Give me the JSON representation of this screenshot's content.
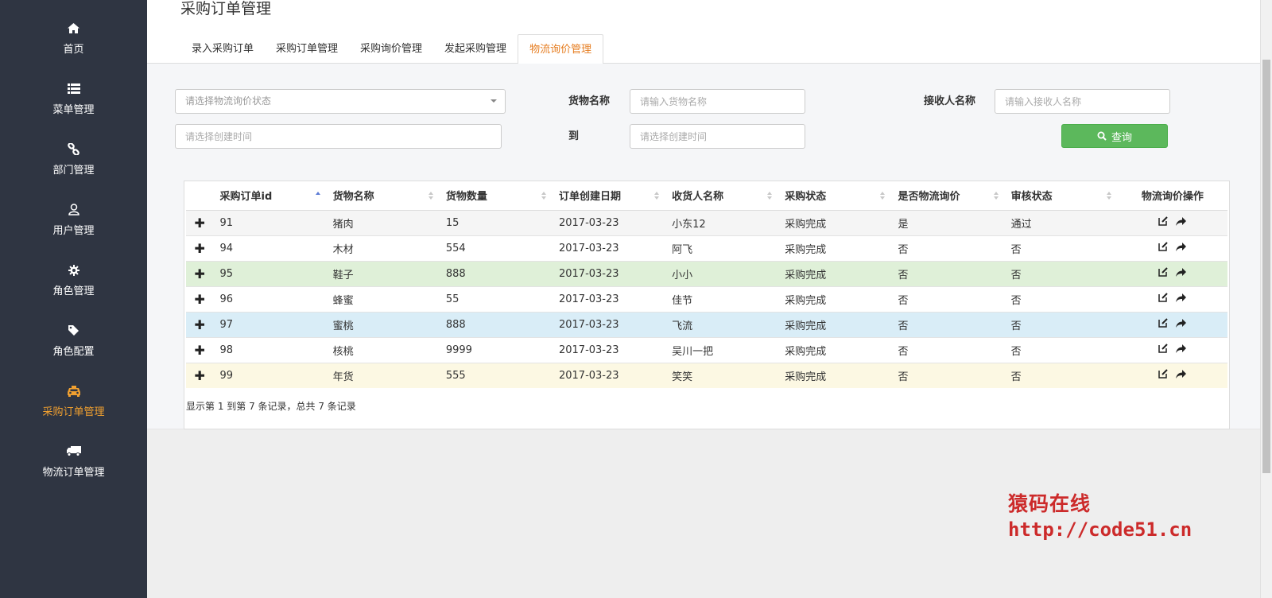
{
  "sidebar": {
    "items": [
      {
        "label": "首页",
        "icon": "home-icon"
      },
      {
        "label": "菜单管理",
        "icon": "list-icon"
      },
      {
        "label": "部门管理",
        "icon": "link-icon"
      },
      {
        "label": "用户管理",
        "icon": "user-icon"
      },
      {
        "label": "角色管理",
        "icon": "gear-icon"
      },
      {
        "label": "角色配置",
        "icon": "tag-icon"
      },
      {
        "label": "采购订单管理",
        "icon": "taxi-icon",
        "active": true
      },
      {
        "label": "物流订单管理",
        "icon": "truck-icon"
      }
    ],
    "active_color": "#f0a030"
  },
  "header": {
    "title": "采购订单管理",
    "tabs": [
      {
        "label": "录入采购订单"
      },
      {
        "label": "采购订单管理"
      },
      {
        "label": "采购询价管理"
      },
      {
        "label": "发起采购管理"
      },
      {
        "label": "物流询价管理",
        "active": true
      }
    ]
  },
  "filters": {
    "status_placeholder": "请选择物流询价状态",
    "goods_label": "货物名称",
    "goods_placeholder": "请输入货物名称",
    "receiver_label": "接收人名称",
    "receiver_placeholder": "请输入接收人名称",
    "created_from_placeholder": "请选择创建时间",
    "to_label": "到",
    "created_to_placeholder": "请选择创建时间",
    "search_label": "查询"
  },
  "table": {
    "columns": [
      "采购订单id",
      "货物名称",
      "货物数量",
      "订单创建日期",
      "收货人名称",
      "采购状态",
      "是否物流询价",
      "审核状态",
      "物流询价操作"
    ],
    "rows": [
      {
        "id": "91",
        "goods": "猪肉",
        "qty": "15",
        "date": "2017-03-23",
        "receiver": "小东12",
        "status": "采购完成",
        "inquiry": "是",
        "audit": "通过"
      },
      {
        "id": "94",
        "goods": "木材",
        "qty": "554",
        "date": "2017-03-23",
        "receiver": "阿飞",
        "status": "采购完成",
        "inquiry": "否",
        "audit": "否"
      },
      {
        "id": "95",
        "goods": "鞋子",
        "qty": "888",
        "date": "2017-03-23",
        "receiver": "小小",
        "status": "采购完成",
        "inquiry": "否",
        "audit": "否"
      },
      {
        "id": "96",
        "goods": "蜂蜜",
        "qty": "55",
        "date": "2017-03-23",
        "receiver": "佳节",
        "status": "采购完成",
        "inquiry": "否",
        "audit": "否"
      },
      {
        "id": "97",
        "goods": "蜜桃",
        "qty": "888",
        "date": "2017-03-23",
        "receiver": "飞流",
        "status": "采购完成",
        "inquiry": "否",
        "audit": "否"
      },
      {
        "id": "98",
        "goods": "核桃",
        "qty": "9999",
        "date": "2017-03-23",
        "receiver": "吴川一把",
        "status": "采购完成",
        "inquiry": "否",
        "audit": "否"
      },
      {
        "id": "99",
        "goods": "年货",
        "qty": "555",
        "date": "2017-03-23",
        "receiver": "笑笑",
        "status": "采购完成",
        "inquiry": "否",
        "audit": "否"
      }
    ],
    "footer": "显示第 1 到第 7 条记录，总共 7 条记录",
    "expand_symbol": "✚"
  },
  "watermark": {
    "line1": "猿码在线",
    "line2": "http://code51.cn"
  },
  "colors": {
    "sidebar_bg": "#2f3542",
    "search_button": "#5cb85c",
    "tab_active": "#e67e22",
    "row_success": "#dff0d8",
    "row_info": "#d9edf7",
    "row_warning": "#fcf8e3",
    "watermark": "#cc2a2a"
  }
}
